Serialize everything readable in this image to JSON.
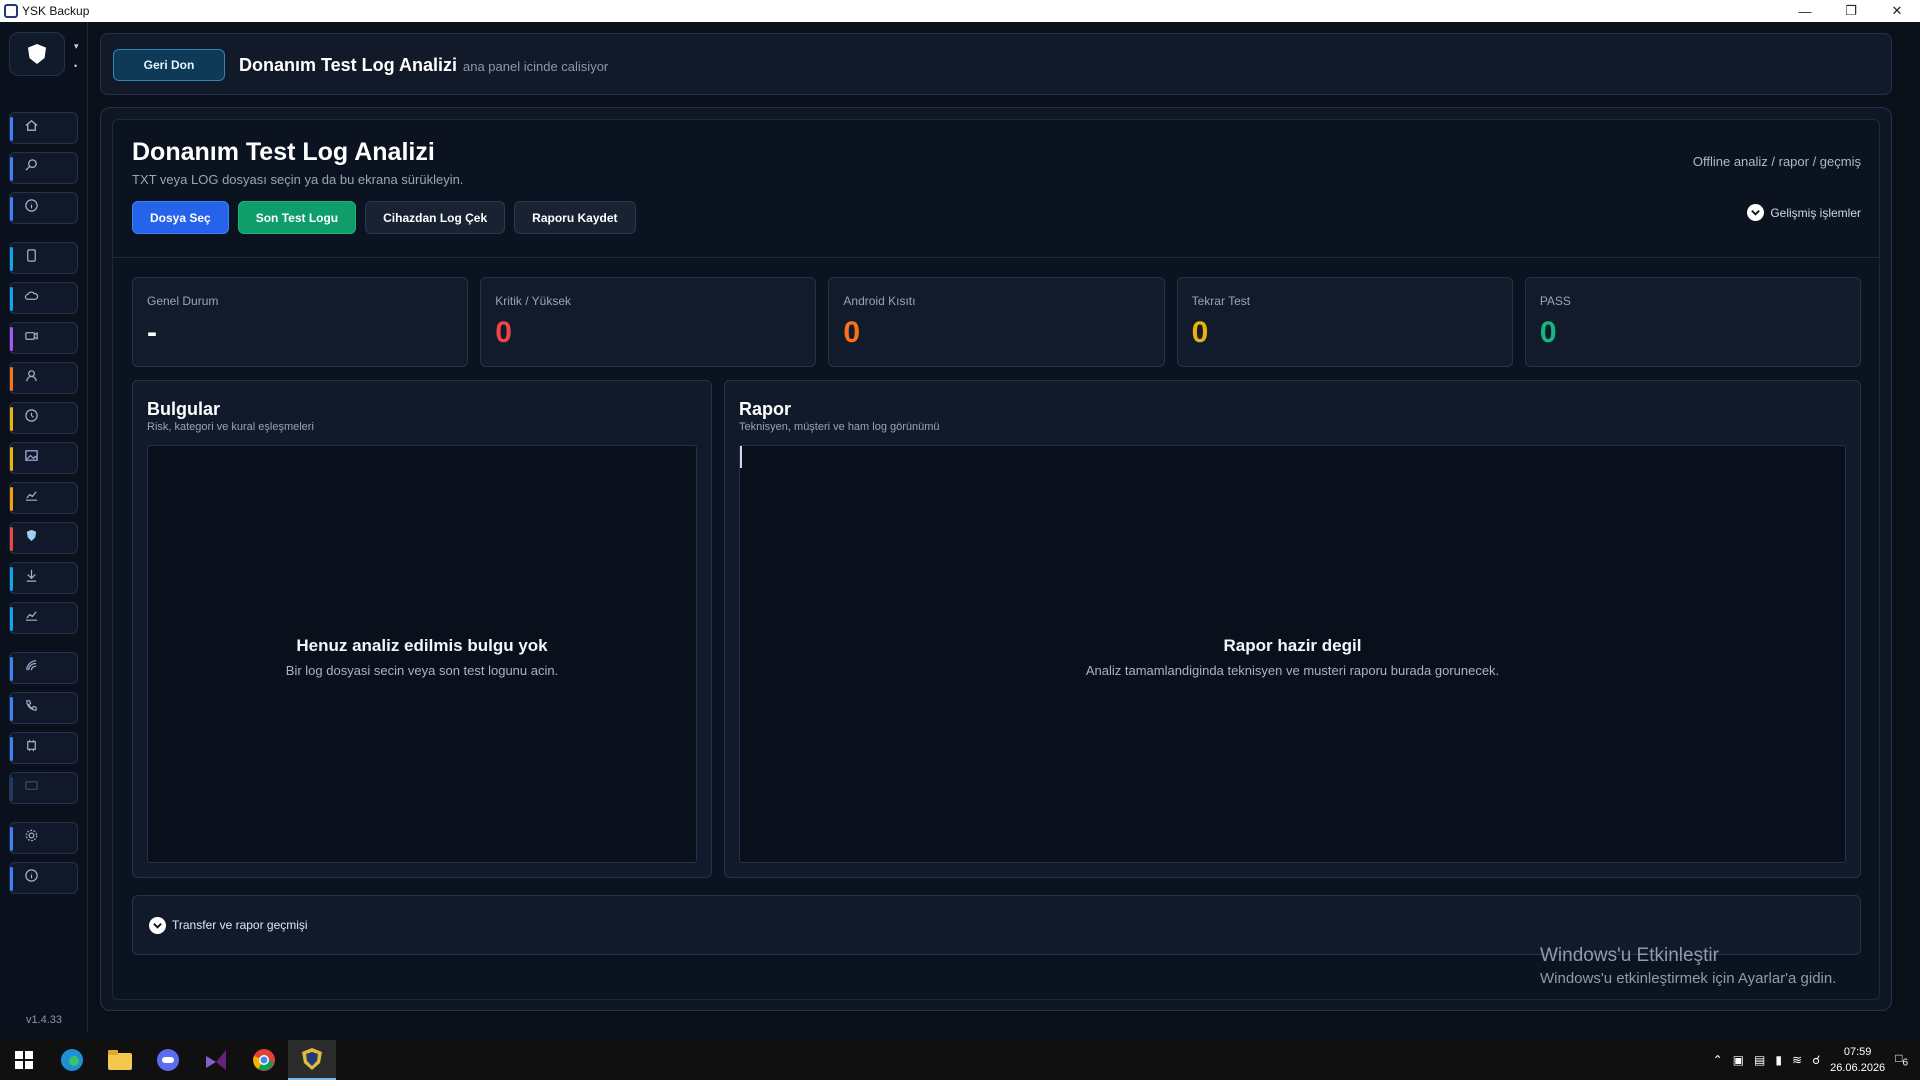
{
  "window": {
    "title": "YSK Backup"
  },
  "sidebar": {
    "version": "v1.4.33",
    "items": [
      {
        "icon": "home-icon",
        "accent": "#3b82f6"
      },
      {
        "icon": "search-icon",
        "accent": "#3b82f6"
      },
      {
        "icon": "info-icon",
        "accent": "#3b82f6"
      },
      {
        "icon": "phone-icon",
        "accent": "#0ea5e9"
      },
      {
        "icon": "cloud-icon",
        "accent": "#0ea5e9"
      },
      {
        "icon": "video-icon",
        "accent": "#a855f7"
      },
      {
        "icon": "user-icon",
        "accent": "#f97316"
      },
      {
        "icon": "history-icon",
        "accent": "#eab308"
      },
      {
        "icon": "image-icon",
        "accent": "#eab308"
      },
      {
        "icon": "chart-icon",
        "accent": "#f59e0b"
      },
      {
        "icon": "shield-icon",
        "accent": "#ef4444"
      },
      {
        "icon": "download-icon",
        "accent": "#0ea5e9"
      },
      {
        "icon": "chart-icon",
        "accent": "#0ea5e9"
      },
      {
        "icon": "signal-icon",
        "accent": "#3b82f6"
      },
      {
        "icon": "call-icon",
        "accent": "#3b82f6"
      },
      {
        "icon": "chip-icon",
        "accent": "#3b82f6"
      },
      {
        "icon": "card-icon",
        "accent": "#1e3a5f"
      },
      {
        "icon": "gear-icon",
        "accent": "#3b82f6"
      },
      {
        "icon": "info-icon",
        "accent": "#3b82f6"
      }
    ]
  },
  "topbar": {
    "back_label": "Geri Don",
    "title": "Donanım Test Log Analizi",
    "subtitle": "ana panel icinde calisiyor"
  },
  "header": {
    "title": "Donanım Test Log Analizi",
    "subtitle": "TXT veya LOG dosyası seçin ya da bu ekrana sürükleyin.",
    "right_text": "Offline analiz / rapor / geçmiş",
    "advanced_label": "Gelişmiş işlemler",
    "buttons": {
      "select_file": "Dosya Seç",
      "last_test": "Son Test Logu",
      "pull_device": "Cihazdan Log Çek",
      "save_report": "Raporu Kaydet"
    }
  },
  "stats": [
    {
      "label": "Genel Durum",
      "value": "-",
      "color": "#ffffff"
    },
    {
      "label": "Kritik / Yüksek",
      "value": "0",
      "color": "#ef4444"
    },
    {
      "label": "Android Kısıtı",
      "value": "0",
      "color": "#f97316"
    },
    {
      "label": "Tekrar Test",
      "value": "0",
      "color": "#eab308"
    },
    {
      "label": "PASS",
      "value": "0",
      "color": "#10b981"
    }
  ],
  "findings": {
    "title": "Bulgular",
    "subtitle": "Risk, kategori ve kural eşleşmeleri",
    "empty_title": "Henuz analiz edilmis bulgu yok",
    "empty_sub": "Bir log dosyasi secin veya son test logunu acin."
  },
  "report": {
    "title": "Rapor",
    "subtitle": "Teknisyen, müşteri ve ham log görünümü",
    "empty_title": "Rapor hazir degil",
    "empty_sub": "Analiz tamamlandiginda teknisyen ve musteri raporu burada gorunecek."
  },
  "history": {
    "label": "Transfer ve rapor geçmişi"
  },
  "watermark": {
    "line1": "Windows'u Etkinleştir",
    "line2": "Windows'u etkinleştirmek için Ayarlar'a gidin."
  },
  "taskbar": {
    "time": "07:59",
    "date": "26.06.2026",
    "notification_count": "6",
    "apps": [
      "windows-start-icon",
      "edge-icon",
      "file-explorer-icon",
      "chat-app-icon",
      "visual-studio-icon",
      "chrome-icon",
      "ysk-backup-icon"
    ]
  }
}
